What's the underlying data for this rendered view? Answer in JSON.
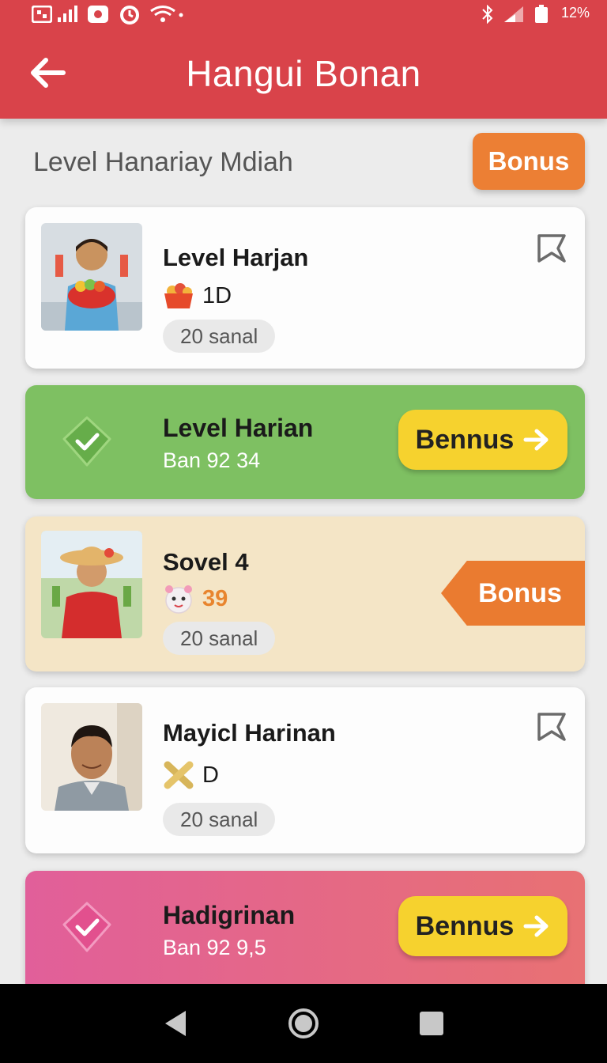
{
  "status_bar": {
    "battery": "12%"
  },
  "app_bar": {
    "title": "Hangui Bonan"
  },
  "page": {
    "heading": "Level Hanariay Mdiah",
    "top_button": "Bonus"
  },
  "cards": [
    {
      "title": "Level Harjan",
      "meta_value": "1D",
      "pill": "20 sanal"
    },
    {
      "title": "Level Harian",
      "subtitle": "Ban 92 34",
      "button": "Bennus"
    },
    {
      "title": "Sovel 4",
      "meta_value": "39",
      "pill": "20 sanal",
      "ribbon": "Bonus"
    },
    {
      "title": "Mayicl Harinan",
      "meta_value": "D",
      "pill": "20 sanal"
    },
    {
      "title": "Hadigrinan",
      "subtitle": "Ban 92 9,5",
      "button": "Bennus"
    }
  ],
  "colors": {
    "app_bar": "#d9434a",
    "orange": "#ec7f34",
    "green_card": "#7ec062",
    "cream_card": "#f4e5c6",
    "yellow_button": "#f6d22e",
    "pink_card": "#e15f9a"
  },
  "icons": {
    "status": [
      "notification-icon",
      "signal-icon",
      "camera-icon",
      "alarm-icon",
      "wifi-icon",
      "bluetooth-icon",
      "signal-icon",
      "battery-icon"
    ],
    "nav": [
      "back-triangle-icon",
      "home-circle-icon",
      "recents-square-icon"
    ]
  }
}
